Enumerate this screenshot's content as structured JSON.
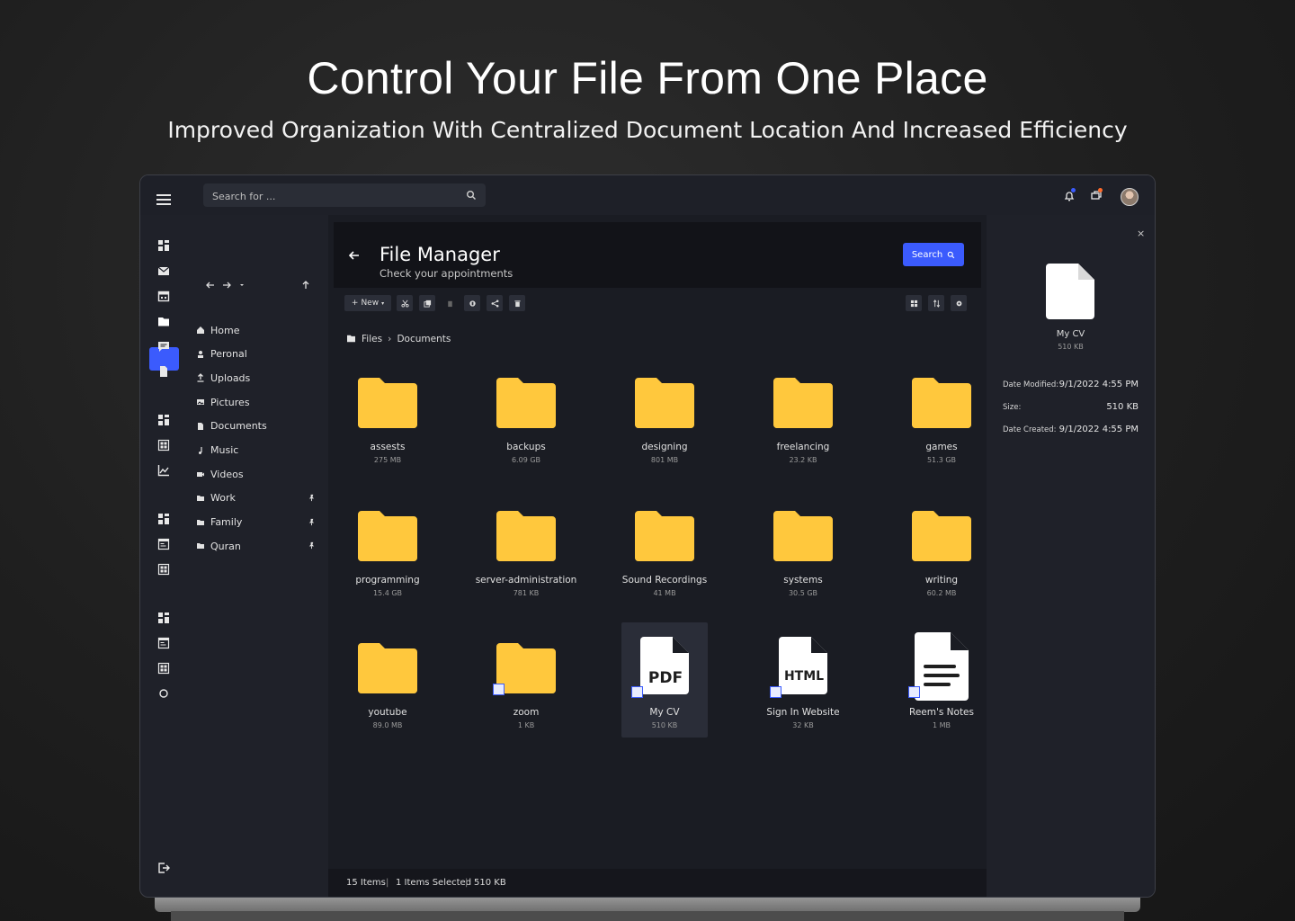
{
  "hero": {
    "title": "Control Your File From One Place",
    "subtitle": "Improved Organization With Centralized Document Location And Increased Efficiency"
  },
  "topbar": {
    "search_placeholder": "Search for ...",
    "notification_dot_color": "#3b5bfd",
    "message_dot_color": "#ff6a2b"
  },
  "sidebar": {
    "items": [
      {
        "label": "Home",
        "icon": "home-icon"
      },
      {
        "label": "Peronal",
        "icon": "person-icon"
      },
      {
        "label": "Uploads",
        "icon": "upload-icon"
      },
      {
        "label": "Pictures",
        "icon": "image-icon"
      },
      {
        "label": "Documents",
        "icon": "file-icon"
      },
      {
        "label": "Music",
        "icon": "music-icon"
      },
      {
        "label": "Videos",
        "icon": "video-icon"
      },
      {
        "label": "Work",
        "icon": "folder-icon",
        "pinned": true
      },
      {
        "label": "Family",
        "icon": "folder-icon",
        "pinned": true
      },
      {
        "label": "Quran",
        "icon": "folder-icon",
        "pinned": true
      }
    ]
  },
  "header": {
    "title": "File Manager",
    "subtitle": "Check your appointments",
    "search_label": "Search",
    "accent": "#3b5bfd"
  },
  "toolbar": {
    "new_label": "New"
  },
  "breadcrumb": {
    "root": "Files",
    "current": "Documents"
  },
  "files": [
    {
      "name": "assests",
      "size": "275 MB",
      "kind": "folder"
    },
    {
      "name": "backups",
      "size": "6.09 GB",
      "kind": "folder"
    },
    {
      "name": "designing",
      "size": "801 MB",
      "kind": "folder"
    },
    {
      "name": "freelancing",
      "size": "23.2 KB",
      "kind": "folder"
    },
    {
      "name": "games",
      "size": "51.3 GB",
      "kind": "folder"
    },
    {
      "name": "programming",
      "size": "15.4 GB",
      "kind": "folder"
    },
    {
      "name": "server-administration",
      "size": "781 KB",
      "kind": "folder"
    },
    {
      "name": "Sound Recordings",
      "size": "41 MB",
      "kind": "folder"
    },
    {
      "name": "systems",
      "size": "30.5 GB",
      "kind": "folder"
    },
    {
      "name": "writing",
      "size": "60.2 MB",
      "kind": "folder"
    },
    {
      "name": "youtube",
      "size": "89.0 MB",
      "kind": "folder"
    },
    {
      "name": "zoom",
      "size": "1 KB",
      "kind": "folder-shortcut"
    },
    {
      "name": "My CV",
      "size": "510 KB",
      "kind": "pdf",
      "badge": "PDF",
      "selected": true
    },
    {
      "name": "Sign In Website",
      "size": "32 KB",
      "kind": "html",
      "badge": "HTML"
    },
    {
      "name": "Reem's Notes",
      "size": "1 MB",
      "kind": "notes"
    }
  ],
  "folder_color": "#ffc83d",
  "status": {
    "items": "15 Items",
    "selected": "1 Items Selected",
    "size": "510 KB"
  },
  "details": {
    "name": "My CV",
    "size": "510 KB",
    "props": [
      {
        "label": "Date Modified:",
        "value": "9/1/2022  4:55 PM"
      },
      {
        "label": "Size:",
        "value": "510 KB"
      },
      {
        "label": "Date Created:",
        "value": "9/1/2022  4:55 PM"
      }
    ]
  }
}
